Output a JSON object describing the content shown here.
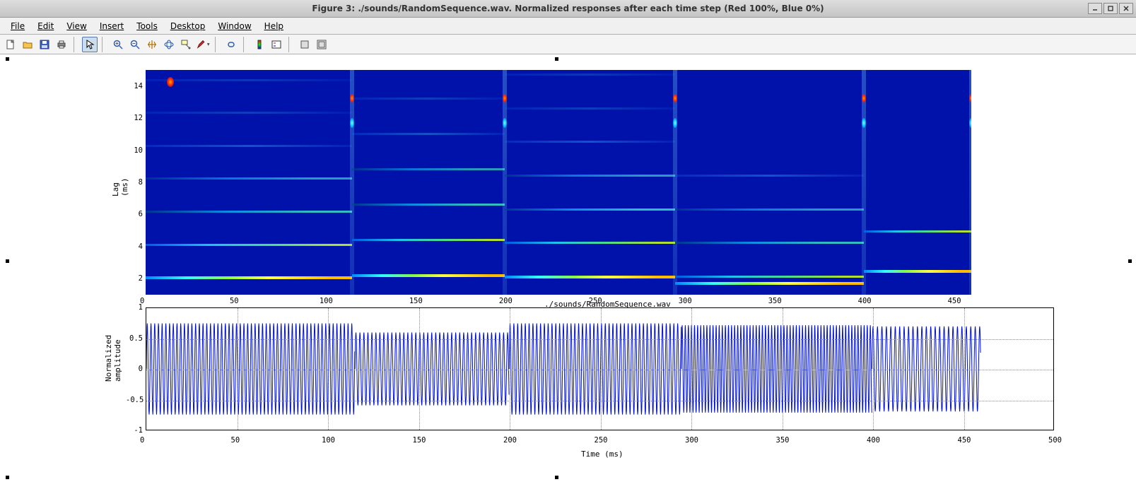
{
  "window": {
    "title": "Figure 3: ./sounds/RandomSequence.wav. Normalized responses after each time step (Red 100%, Blue 0%)",
    "minimize_icon_tip": "Minimize",
    "maximize_icon_tip": "Maximize",
    "close_icon_tip": "Close"
  },
  "menubar": {
    "file": "File",
    "edit": "Edit",
    "view": "View",
    "insert": "Insert",
    "tools": "Tools",
    "desktop": "Desktop",
    "window": "Window",
    "help": "Help"
  },
  "toolbar": {
    "new": "New Figure",
    "open": "Open File",
    "save": "Save Figure",
    "print": "Print Figure",
    "pointer": "Edit Plot",
    "zoom_in": "Zoom In",
    "zoom_out": "Zoom Out",
    "pan": "Pan",
    "rotate3d": "Rotate 3D",
    "data_cursor": "Data Cursor",
    "brush": "Brush",
    "link": "Link Plot",
    "colorbar": "Insert Colorbar",
    "legend": "Insert Legend",
    "hide": "Hide Plot Tools",
    "show": "Show Plot Tools"
  },
  "chart_data": [
    {
      "type": "heatmap",
      "title": "",
      "ylabel": "Lag (ms)",
      "xlabel": "",
      "x_range": [
        0,
        460
      ],
      "y_range": [
        1,
        15
      ],
      "yticks": [
        2,
        4,
        6,
        8,
        10,
        12,
        14
      ],
      "xticks": [
        0,
        50,
        100,
        150,
        200,
        250,
        300,
        350,
        400,
        450
      ],
      "segments": [
        {
          "x_start": 0,
          "x_end": 115,
          "harmonic_lags_ms": [
            2.05,
            4.1,
            6.15,
            8.2,
            10.25,
            12.3,
            14.35
          ]
        },
        {
          "x_start": 115,
          "x_end": 200,
          "harmonic_lags_ms": [
            2.2,
            4.4,
            6.6,
            8.8,
            11.0,
            13.2
          ]
        },
        {
          "x_start": 200,
          "x_end": 295,
          "harmonic_lags_ms": [
            2.1,
            4.2,
            6.3,
            8.4,
            10.5,
            12.6,
            14.7
          ]
        },
        {
          "x_start": 295,
          "x_end": 400,
          "harmonic_lags_ms": [
            1.7,
            2.1,
            4.2,
            6.3,
            8.4
          ]
        },
        {
          "x_start": 400,
          "x_end": 460,
          "harmonic_lags_ms": [
            2.45,
            4.9
          ]
        }
      ],
      "colorscale": "jet",
      "colorscale_meaning": "Red 100%, Blue 0%"
    },
    {
      "type": "line",
      "title": "./sounds/RandomSequence.wav",
      "ylabel": "Normalized amplitude",
      "xlabel": "Time (ms)",
      "x_range": [
        0,
        500
      ],
      "y_range": [
        -1,
        1
      ],
      "yticks": [
        -1,
        -0.5,
        0,
        0.5,
        1
      ],
      "xticks": [
        0,
        50,
        100,
        150,
        200,
        250,
        300,
        350,
        400,
        450,
        500
      ],
      "segments": [
        {
          "x_start": 0,
          "x_end": 115,
          "period_ms": 2.05,
          "amplitude": 0.75
        },
        {
          "x_start": 115,
          "x_end": 200,
          "period_ms": 2.2,
          "amplitude": 0.6
        },
        {
          "x_start": 200,
          "x_end": 295,
          "period_ms": 2.1,
          "amplitude": 0.75
        },
        {
          "x_start": 295,
          "x_end": 400,
          "period_ms": 1.7,
          "amplitude": 0.72
        },
        {
          "x_start": 400,
          "x_end": 460,
          "period_ms": 2.45,
          "amplitude": 0.7
        }
      ]
    }
  ]
}
